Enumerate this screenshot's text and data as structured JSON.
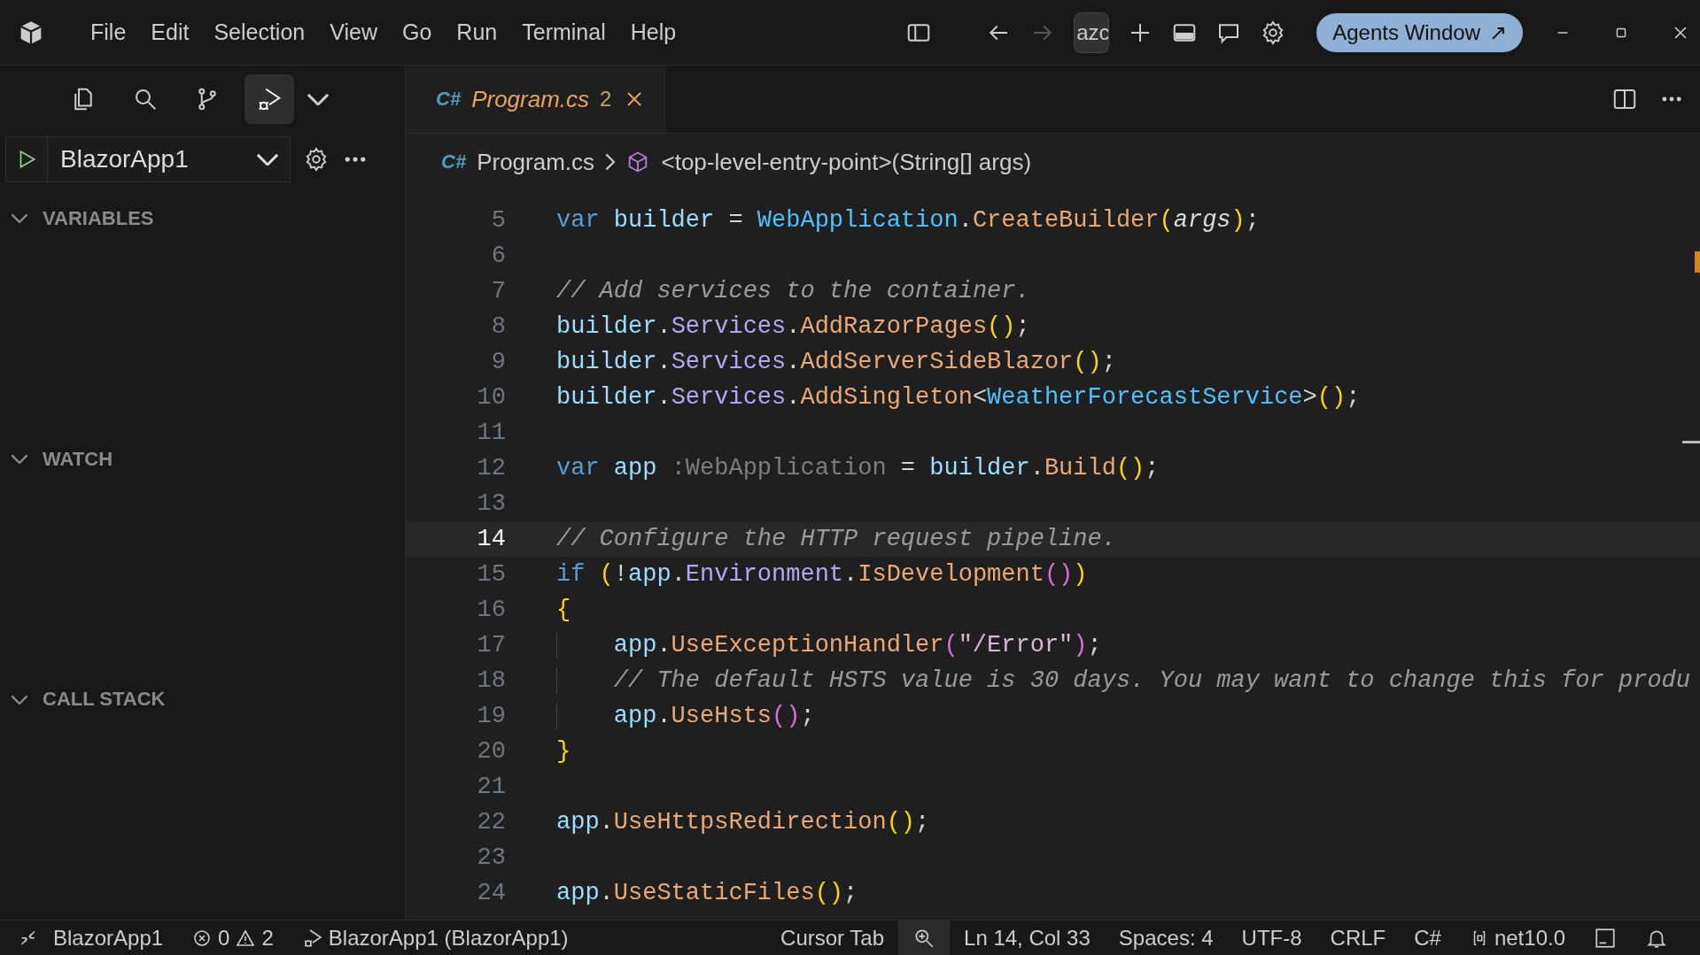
{
  "title_bar": {
    "menus": [
      "File",
      "Edit",
      "Selection",
      "View",
      "Go",
      "Run",
      "Terminal",
      "Help"
    ],
    "search_text": "azc",
    "agents_button": {
      "label": "Agents Window",
      "icon": "↗"
    }
  },
  "activity_bar": [
    {
      "kind": "explorer",
      "selected": false
    },
    {
      "kind": "search",
      "selected": false
    },
    {
      "kind": "source-control",
      "selected": false
    },
    {
      "kind": "run-debug",
      "selected": true
    }
  ],
  "run_config": {
    "name": "BlazorApp1"
  },
  "sections": [
    {
      "title": "VARIABLES",
      "expanded": true
    },
    {
      "title": "WATCH",
      "expanded": true
    },
    {
      "title": "CALL STACK",
      "expanded": true
    }
  ],
  "tab": {
    "icon_label": "C#",
    "name": "Program.cs",
    "problems": "2",
    "preview": true
  },
  "breadcrumbs": [
    {
      "kind": "file",
      "icon_label": "C#",
      "text": "Program.cs"
    },
    {
      "kind": "method",
      "text": "<top-level-entry-point>(String[] args)"
    }
  ],
  "code_lines": [
    {
      "number": "5",
      "current": false,
      "tokens": [
        {
          "text": "var ",
          "kind": "keyword"
        },
        {
          "text": "builder",
          "kind": "variable"
        },
        {
          "text": " = ",
          "kind": "plain"
        },
        {
          "text": "WebApplication",
          "kind": "type"
        },
        {
          "text": ".",
          "kind": "plain"
        },
        {
          "text": "CreateBuilder",
          "kind": "method"
        },
        {
          "text": "(",
          "kind": "bracket"
        },
        {
          "text": "args",
          "kind": "param"
        },
        {
          "text": ")",
          "kind": "bracket"
        },
        {
          "text": ";",
          "kind": "plain"
        }
      ]
    },
    {
      "number": "6",
      "current": false
    },
    {
      "number": "7",
      "current": false,
      "tokens": [
        {
          "text": "// Add services to the container.",
          "kind": "comment"
        }
      ]
    },
    {
      "number": "8",
      "current": false,
      "tokens": [
        {
          "text": "builder",
          "kind": "variable"
        },
        {
          "text": ".",
          "kind": "plain"
        },
        {
          "text": "Services",
          "kind": "property"
        },
        {
          "text": ".",
          "kind": "plain"
        },
        {
          "text": "AddRazorPages",
          "kind": "method"
        },
        {
          "text": "()",
          "kind": "bracket"
        },
        {
          "text": ";",
          "kind": "plain"
        }
      ]
    },
    {
      "number": "9",
      "current": false,
      "tokens": [
        {
          "text": "builder",
          "kind": "variable"
        },
        {
          "text": ".",
          "kind": "plain"
        },
        {
          "text": "Services",
          "kind": "property"
        },
        {
          "text": ".",
          "kind": "plain"
        },
        {
          "text": "AddServerSideBlazor",
          "kind": "method"
        },
        {
          "text": "()",
          "kind": "bracket"
        },
        {
          "text": ";",
          "kind": "plain"
        }
      ]
    },
    {
      "number": "10",
      "current": false,
      "tokens": [
        {
          "text": "builder",
          "kind": "variable"
        },
        {
          "text": ".",
          "kind": "plain"
        },
        {
          "text": "Services",
          "kind": "property"
        },
        {
          "text": ".",
          "kind": "plain"
        },
        {
          "text": "AddSingleton",
          "kind": "method"
        },
        {
          "text": "<",
          "kind": "plain"
        },
        {
          "text": "WeatherForecastService",
          "kind": "type"
        },
        {
          "text": ">",
          "kind": "plain"
        },
        {
          "text": "()",
          "kind": "bracket"
        },
        {
          "text": ";",
          "kind": "plain"
        }
      ]
    },
    {
      "number": "11",
      "current": false
    },
    {
      "number": "12",
      "current": false,
      "tokens": [
        {
          "text": "var ",
          "kind": "keyword"
        },
        {
          "text": "app ",
          "kind": "variable"
        },
        {
          "text": ":WebApplication",
          "kind": "hint"
        },
        {
          "text": " = ",
          "kind": "plain"
        },
        {
          "text": "builder",
          "kind": "variable"
        },
        {
          "text": ".",
          "kind": "plain"
        },
        {
          "text": "Build",
          "kind": "method"
        },
        {
          "text": "()",
          "kind": "bracket"
        },
        {
          "text": ";",
          "kind": "plain"
        }
      ]
    },
    {
      "number": "13",
      "current": false
    },
    {
      "number": "14",
      "current": true,
      "tokens": [
        {
          "text": "// Configure the HTTP request pipeline.",
          "kind": "comment"
        }
      ]
    },
    {
      "number": "15",
      "current": false,
      "tokens": [
        {
          "text": "if ",
          "kind": "keyword"
        },
        {
          "text": "(",
          "kind": "bracket"
        },
        {
          "text": "!",
          "kind": "plain"
        },
        {
          "text": "app",
          "kind": "variable"
        },
        {
          "text": ".",
          "kind": "plain"
        },
        {
          "text": "Environment",
          "kind": "property"
        },
        {
          "text": ".",
          "kind": "plain"
        },
        {
          "text": "IsDevelopment",
          "kind": "method"
        },
        {
          "text": "()",
          "kind": "bracket2"
        },
        {
          "text": ")",
          "kind": "bracket"
        }
      ]
    },
    {
      "number": "16",
      "current": false,
      "tokens": [
        {
          "text": "{",
          "kind": "bracket"
        }
      ]
    },
    {
      "number": "17",
      "current": false,
      "indented": true,
      "tokens": [
        {
          "text": "app",
          "kind": "variable"
        },
        {
          "text": ".",
          "kind": "plain"
        },
        {
          "text": "UseExceptionHandler",
          "kind": "method"
        },
        {
          "text": "(",
          "kind": "bracket2"
        },
        {
          "text": "\"/Error\"",
          "kind": "string"
        },
        {
          "text": ")",
          "kind": "bracket2"
        },
        {
          "text": ";",
          "kind": "plain"
        }
      ]
    },
    {
      "number": "18",
      "current": false,
      "indented": true,
      "tokens": [
        {
          "text": "// The default HSTS value is 30 days. You may want to change this for produ",
          "kind": "comment"
        }
      ]
    },
    {
      "number": "19",
      "current": false,
      "indented": true,
      "tokens": [
        {
          "text": "app",
          "kind": "variable"
        },
        {
          "text": ".",
          "kind": "plain"
        },
        {
          "text": "UseHsts",
          "kind": "method"
        },
        {
          "text": "()",
          "kind": "bracket2"
        },
        {
          "text": ";",
          "kind": "plain"
        }
      ]
    },
    {
      "number": "20",
      "current": false,
      "tokens": [
        {
          "text": "}",
          "kind": "bracket"
        }
      ]
    },
    {
      "number": "21",
      "current": false
    },
    {
      "number": "22",
      "current": false,
      "tokens": [
        {
          "text": "app",
          "kind": "variable"
        },
        {
          "text": ".",
          "kind": "plain"
        },
        {
          "text": "UseHttpsRedirection",
          "kind": "method"
        },
        {
          "text": "()",
          "kind": "bracket"
        },
        {
          "text": ";",
          "kind": "plain"
        }
      ]
    },
    {
      "number": "23",
      "current": false
    },
    {
      "number": "24",
      "current": false,
      "tokens": [
        {
          "text": "app",
          "kind": "variable"
        },
        {
          "text": ".",
          "kind": "plain"
        },
        {
          "text": "UseStaticFiles",
          "kind": "method"
        },
        {
          "text": "()",
          "kind": "bracket"
        },
        {
          "text": ";",
          "kind": "plain"
        }
      ]
    }
  ],
  "status_bar": {
    "project": "BlazorApp1",
    "errors": "0",
    "warnings": "2",
    "debug_target": "BlazorApp1 (BlazorApp1)",
    "cursor_tab": "Cursor Tab",
    "position": "Ln 14, Col 33",
    "spaces": "Spaces: 4",
    "encoding": "UTF-8",
    "line_ending": "CRLF",
    "language": "C#",
    "framework": "net10.0"
  }
}
